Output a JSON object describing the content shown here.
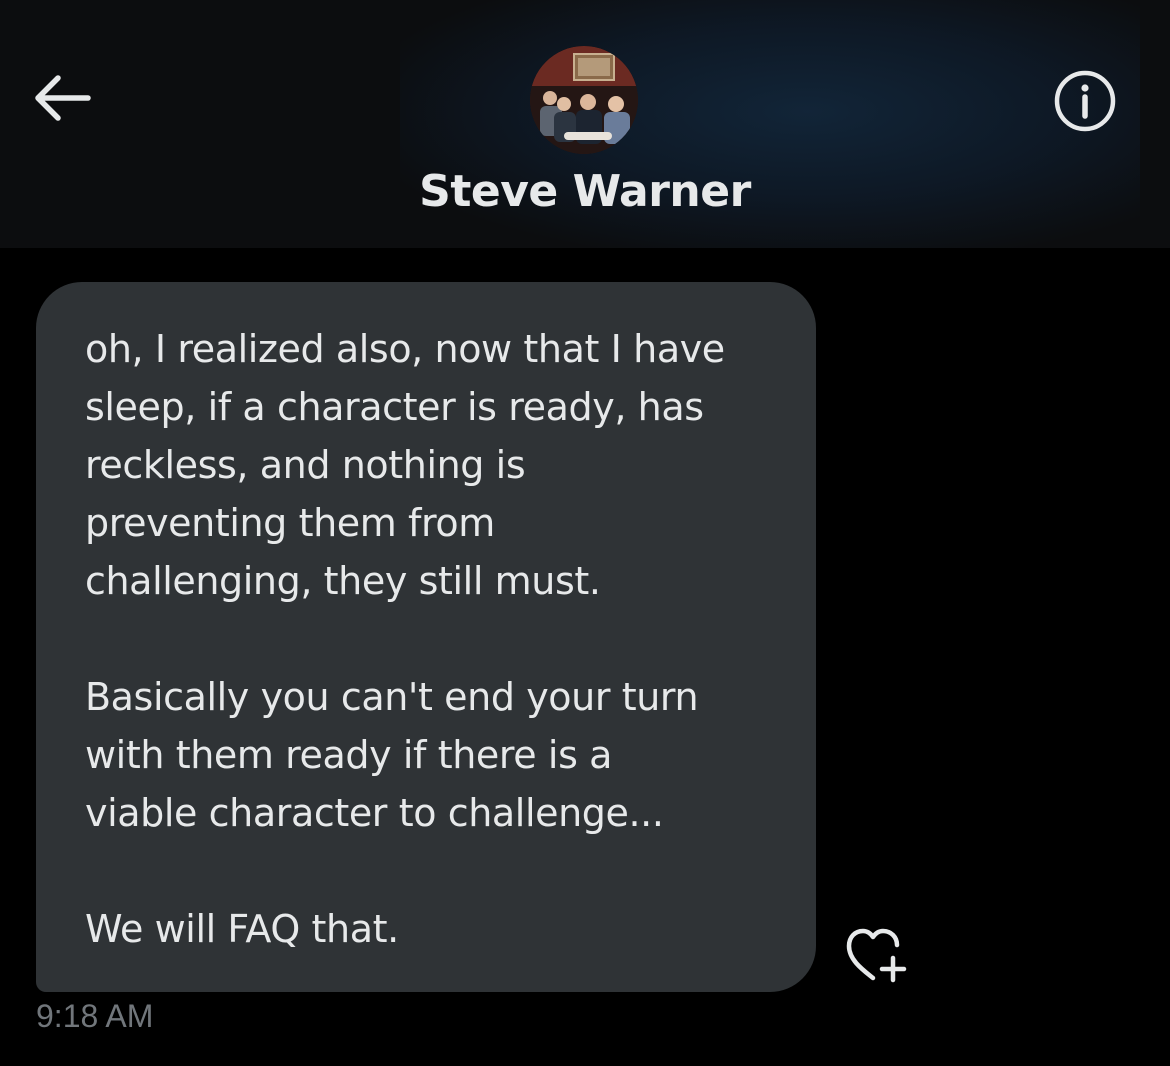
{
  "header": {
    "contact_name": "Steve Warner",
    "back_icon": "arrow-left-icon",
    "info_icon": "info-circle-icon",
    "avatar_description": "avatar"
  },
  "conversation": {
    "messages": [
      {
        "text": "oh, I realized also, now that I have\nsleep, if a character is ready, has\nreckless, and nothing is\npreventing them from\nchallenging, they still must.\n\nBasically you can't end your turn\nwith them ready if there is a\nviable character to challenge...\n\nWe will FAQ that.",
        "timestamp": "9:18 AM",
        "reaction_icon": "heart-plus-icon"
      }
    ]
  },
  "colors": {
    "background": "#000000",
    "header_background": "#0c0d0f",
    "bubble_background": "#2f3336",
    "text_primary": "#e7e9ea",
    "text_secondary": "#71767b"
  }
}
